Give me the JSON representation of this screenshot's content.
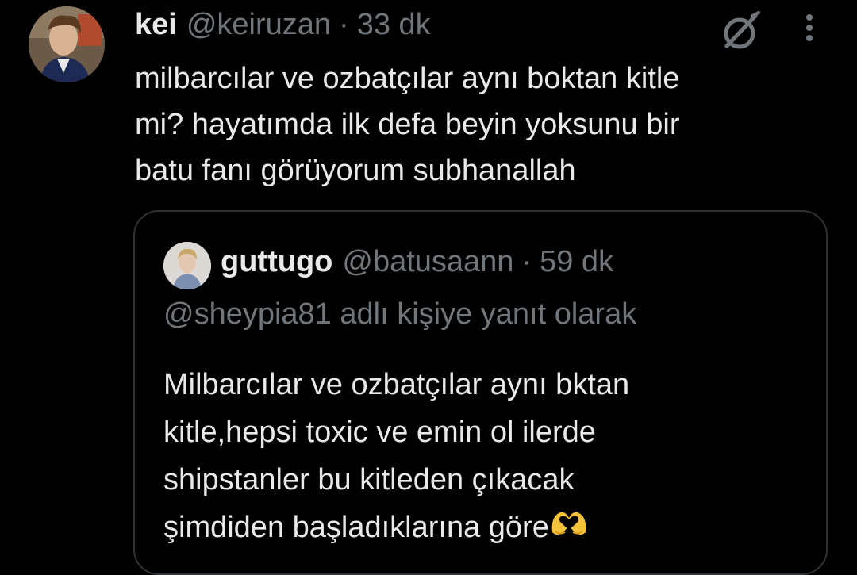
{
  "tweet": {
    "display_name": "kei",
    "handle": "@keiruzan",
    "separator": "·",
    "time": "33 dk",
    "text": "milbarcılar ve ozbatçılar aynı boktan kitle\nmi? hayatımda ilk defa beyin yoksunu bir\nbatu fanı görüyorum subhanallah"
  },
  "quote": {
    "display_name": "guttugo",
    "handle": "@batusaann",
    "separator": "·",
    "time": "59 dk",
    "reply_to": "@sheypia81 adlı kişiye yanıt olarak",
    "text": "Milbarcılar ve ozbatçılar aynı bktan\nkitle,hepsi toxic ve emin ol ilerde\nshipstanler bu kitleden çıkacak\nşimdiden başladıklarına göre",
    "emoji": "heart-hands-emoji"
  },
  "icons": {
    "grok": "grok-icon",
    "more": "more-vertical-icon"
  },
  "colors": {
    "background": "#000000",
    "text_primary": "#e7e9ea",
    "text_secondary": "#71767b",
    "border": "#2f3336",
    "emoji_yellow": "#f5c33b"
  }
}
